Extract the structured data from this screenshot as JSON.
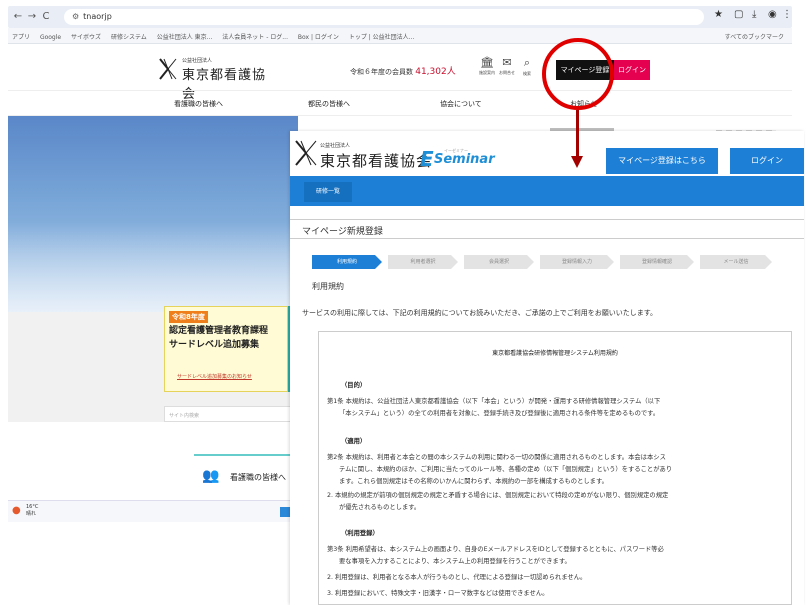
{
  "browser": {
    "url": "tnaorjp",
    "back": "←",
    "forward": "→",
    "reload": "C",
    "bookmarks": [
      "アプリ",
      "Google",
      "サイボウズ",
      "研修システム",
      "公益社団法人 東京...",
      "法人会員ネット - ログ...",
      "Box | ログイン",
      "トップ | 公益社団法人..."
    ],
    "bookmarks_right": "すべてのブックマーク"
  },
  "site": {
    "org_sub": "公益社団法人",
    "org_name": "東京都看護協会",
    "member_label": "令和６年度の会員数",
    "member_count": "41,302人",
    "icons": [
      {
        "name": "facility-icon",
        "glyph": "🏛",
        "label": "施設案内"
      },
      {
        "name": "mail-icon",
        "glyph": "✉",
        "label": "お問合せ"
      },
      {
        "name": "search-icon",
        "glyph": "⌕",
        "label": "検索"
      }
    ],
    "mypage_btn": "マイページ登録",
    "login_btn": "ログイン",
    "nav": [
      "看護職の皆様へ",
      "都民の皆様へ",
      "協会について",
      "お知らせ"
    ],
    "banner": {
      "tag": "令和8年度",
      "line1": "認定看護管理者教育課程",
      "line2": "サードレベル追加募集",
      "link": "サードレベル追加募集のお知らせ"
    },
    "search_placeholder": "サイト内検索",
    "nurse_card": "看護職の皆様へ",
    "taskbar": {
      "weather": "16°C",
      "weather_sub": "晴れ"
    }
  },
  "overlay": {
    "org_sub": "公益社団法人",
    "org_name": "東京都看護協会",
    "ez_logo": {
      "e": "E",
      "word": "Seminar",
      "tiny": "イーゼミナー"
    },
    "register_btn": "マイページ登録はこちら",
    "login_btn": "ログイン",
    "nav_tab": "研修一覧",
    "page_title": "マイページ新規登録",
    "steps": [
      "利用規約",
      "利用者選択",
      "会員選択",
      "登録情報入力",
      "登録情報確認",
      "メール送信"
    ],
    "section_label": "利用規約",
    "intro": "サービスの利用に際しては、下記の利用規約についてお読みいただき、ご承諾の上でご利用をお願いいたします。",
    "terms": {
      "title": "東京都看護協会研修情報管理システム利用規約",
      "h1": "（目的）",
      "a1_1": "第1条  本規約は、公益社団法人東京都看護協会（以下「本会」という）が開発・運用する研修情報管理システム（以下",
      "a1_2": "「本システム」という）の全ての利用者を対象に、登録手続き及び登録後に適用される条件等を定めるものです。",
      "h2": "（適用）",
      "a2_1": "第2条  本規約は、利用者と本会との間の本システムの利用に関わる一切の関係に適用されるものとします。本会は本シス",
      "a2_2": "テムに関し、本規約のほか、ご利用に当たってのルール等、各種の定め（以下「個別規定」という）をすることがあり",
      "a2_3": "ます。これら個別規定はその名称のいかんに関わらず、本規約の一部を構成するものとします。",
      "a2_4": "2. 本規約の規定が前項の個別規定の規定と矛盾する場合には、個別規定において特段の定めがない限り、個別規定の規定",
      "a2_5": "が優先されるものとします。",
      "h3": "（利用登録）",
      "a3_1": "第3条  利用希望者は、本システム上の画面より、自身のEメールアドレスをIDとして登録するとともに、パスワード等必",
      "a3_2": "要な事項を入力することにより、本システム上の利用登録を行うことができます。",
      "a3_3": "2. 利用登録は、利用者となる本人が行うものとし、代理による登録は一切認められません。",
      "a3_4": "3. 利用登録において、特殊文字・旧漢字・ローマ数字などは使用できません。"
    }
  },
  "colors": {
    "accent": "#1e7fd6",
    "callout": "#e00000",
    "login_pink": "#e60050"
  }
}
